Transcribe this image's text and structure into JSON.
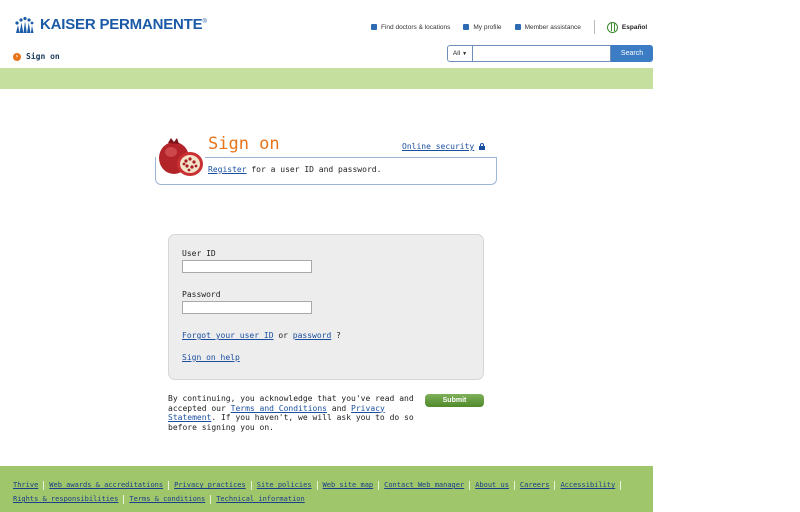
{
  "header": {
    "logo_text": "KAISER PERMANENTE",
    "logo_mark": "®",
    "top_links": [
      {
        "label": "Find doctors & locations"
      },
      {
        "label": "My profile"
      },
      {
        "label": "Member assistance"
      }
    ],
    "language_link": "Español",
    "breadcrumb": "Sign on",
    "search": {
      "scope": "All",
      "button": "Search",
      "placeholder": ""
    }
  },
  "signon": {
    "title": "Sign on",
    "online_security": "Online security",
    "register_link": "Register",
    "register_text": " for a user ID and password."
  },
  "form": {
    "user_id_label": "User ID",
    "password_label": "Password",
    "forgot_user_id": "Forgot your user ID",
    "or": " or ",
    "forgot_password": "password",
    "question": " ?",
    "help": "Sign on help"
  },
  "consent": {
    "text1": "By continuing, you acknowledge that you've read and accepted our ",
    "terms": "Terms and Conditions",
    "and": " and ",
    "privacy": "Privacy Statement",
    "text2": ". If you haven't, we will ask you to do so before signing you on.",
    "submit": "Submit"
  },
  "footer": {
    "row1": [
      "Thrive",
      "Web awards & accreditations",
      "Privacy practices",
      "Site policies",
      "Web site map",
      "Contact Web manager",
      "About us",
      "Careers",
      "Accessibility"
    ],
    "row2": [
      "Rights & responsibilities",
      "Terms & conditions",
      "Technical information"
    ]
  },
  "colors": {
    "brand_blue": "#1a5aa6",
    "accent_orange": "#e8741a",
    "band_green": "#c5df9f",
    "footer_green": "#9fc66a",
    "submit_green": "#4f8a2a"
  },
  "icons": [
    "kp-logo-icon",
    "globe-icon",
    "arrow-icon",
    "lock-icon",
    "pomegranate-icon",
    "dropdown-arrow-icon"
  ]
}
